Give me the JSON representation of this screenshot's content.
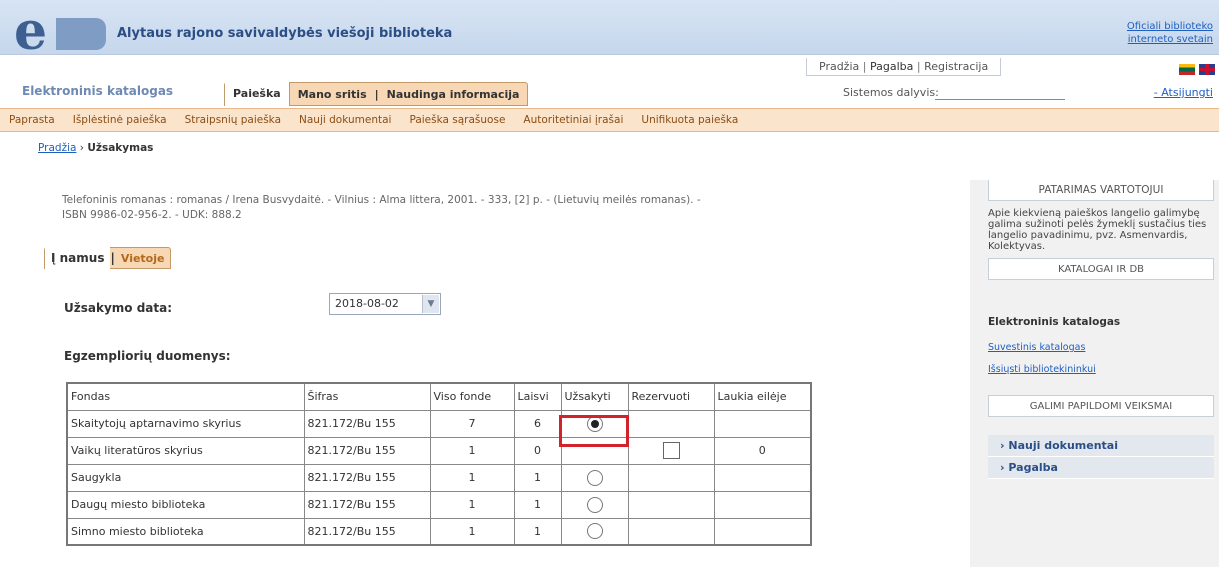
{
  "header": {
    "site_title": "Alytaus rajono savivaldybės viešoji biblioteka",
    "official_link_line1": "Oficiali biblioteko",
    "official_link_line2": "interneto svetain",
    "top_links": [
      "Pradžia",
      "Pagalba",
      "Registracija"
    ],
    "catalog_name": "Elektroninis katalogas",
    "tabs": [
      "Paieška",
      "Mano sritis",
      "Naudinga informacija"
    ],
    "participant_label": "Sistemos dalyvis:",
    "logout_label": "Atsijungti"
  },
  "subnav": [
    "Paprasta",
    "Išplėstinė paieška",
    "Straipsnių paieška",
    "Nauji dokumentai",
    "Paieška sąrašuose",
    "Autoritetiniai įrašai",
    "Unifikuota paieška"
  ],
  "breadcrumb": {
    "home": "Pradžia",
    "separator": "›",
    "current": "Užsakymas"
  },
  "record": {
    "line1": "Telefoninis romanas : romanas / Irena Busvydaitė. - Vilnius : Alma littera, 2001. - 333, [2] p. - (Lietuvių meilės romanas). -",
    "line2": "ISBN 9986-02-956-2. - UDK: 888.2"
  },
  "form_tabs": {
    "active": "Į namus",
    "separator": "|",
    "other": "Vietoje"
  },
  "order": {
    "date_label": "Užsakymo data:",
    "date_value": "2018-08-02",
    "items_label": "Egzempliorių duomenys:"
  },
  "table": {
    "headers": [
      "Fondas",
      "Šifras",
      "Viso fonde",
      "Laisvi",
      "Užsakyti",
      "Rezervuoti",
      "Laukia eilėje"
    ],
    "rows": [
      {
        "fondas": "Skaitytojų aptarnavimo skyrius",
        "sifras": "821.172/Bu 155",
        "viso": "7",
        "laisvi": "6",
        "uzsakyti": "radio-checked",
        "rezervuoti": "",
        "laukia": ""
      },
      {
        "fondas": "Vaikų literatūros skyrius",
        "sifras": "821.172/Bu 155",
        "viso": "1",
        "laisvi": "0",
        "uzsakyti": "",
        "rezervuoti": "checkbox",
        "laukia": "0"
      },
      {
        "fondas": "Saugykla",
        "sifras": "821.172/Bu 155",
        "viso": "1",
        "laisvi": "1",
        "uzsakyti": "radio",
        "rezervuoti": "",
        "laukia": ""
      },
      {
        "fondas": "Daugų miesto biblioteka",
        "sifras": "821.172/Bu 155",
        "viso": "1",
        "laisvi": "1",
        "uzsakyti": "radio",
        "rezervuoti": "",
        "laukia": ""
      },
      {
        "fondas": "Simno miesto biblioteka",
        "sifras": "821.172/Bu 155",
        "viso": "1",
        "laisvi": "1",
        "uzsakyti": "radio",
        "rezervuoti": "",
        "laukia": ""
      }
    ]
  },
  "sidebar": {
    "advice_title": "PATARIMAS VARTOTOJUI",
    "advice_text": "Apie kiekvieną paieškos langelio galimybę galima sužinoti pelės žymeklį sustačius ties langelio pavadinimu, pvz. Asmenvardis, Kolektyvas.",
    "catalogs_title": "KATALOGAI IR DB",
    "catalog_name": "Elektroninis katalogas",
    "links": [
      "Suvestinis katalogas",
      "Išsiųsti bibliotekininkui"
    ],
    "actions_title": "GALIMI PAPILDOMI VEIKSMAI",
    "actions": [
      "Nauji dokumentai",
      "Pagalba"
    ]
  },
  "colors": {
    "accent": "#2c4e86",
    "tab_bg": "#f7d7b4",
    "subnav_bg": "#fbe4cc",
    "highlight": "#d2232a"
  }
}
